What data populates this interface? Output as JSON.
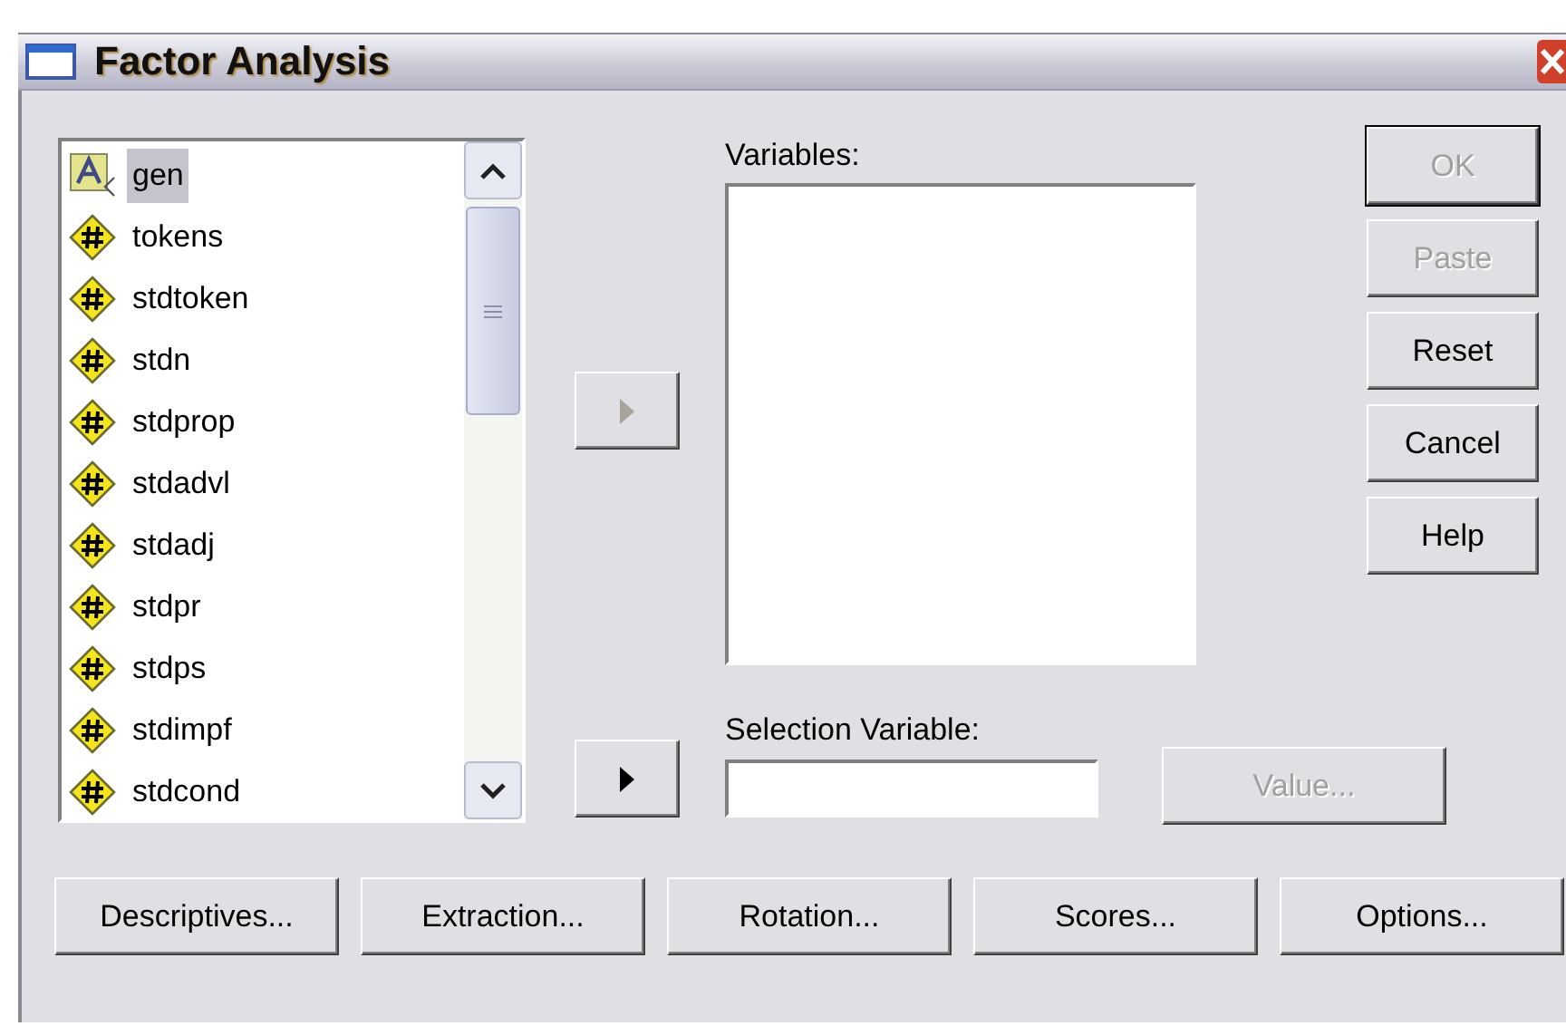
{
  "window": {
    "title": "Factor Analysis"
  },
  "source_list": {
    "items": [
      {
        "name": "gen",
        "kind": "string",
        "selected": true
      },
      {
        "name": "tokens",
        "kind": "numeric",
        "selected": false
      },
      {
        "name": "stdtoken",
        "kind": "numeric",
        "selected": false
      },
      {
        "name": "stdn",
        "kind": "numeric",
        "selected": false
      },
      {
        "name": "stdprop",
        "kind": "numeric",
        "selected": false
      },
      {
        "name": "stdadvl",
        "kind": "numeric",
        "selected": false
      },
      {
        "name": "stdadj",
        "kind": "numeric",
        "selected": false
      },
      {
        "name": "stdpr",
        "kind": "numeric",
        "selected": false
      },
      {
        "name": "stdps",
        "kind": "numeric",
        "selected": false
      },
      {
        "name": "stdimpf",
        "kind": "numeric",
        "selected": false
      },
      {
        "name": "stdcond",
        "kind": "numeric",
        "selected": false
      }
    ]
  },
  "move_buttons": [
    {
      "disabled": true
    },
    {
      "disabled": false
    }
  ],
  "variables": {
    "label": "Variables:"
  },
  "selection_variable": {
    "label": "Selection Variable:",
    "value_button": {
      "label": "Value...",
      "disabled": true
    }
  },
  "action_buttons": [
    {
      "label": "OK",
      "disabled": true,
      "default": true
    },
    {
      "label": "Paste",
      "disabled": true,
      "default": false
    },
    {
      "label": "Reset",
      "disabled": false,
      "default": false
    },
    {
      "label": "Cancel",
      "disabled": false,
      "default": false
    },
    {
      "label": "Help",
      "disabled": false,
      "default": false
    }
  ],
  "bottom_buttons": [
    {
      "label": "Descriptives..."
    },
    {
      "label": "Extraction..."
    },
    {
      "label": "Rotation..."
    },
    {
      "label": "Scores..."
    },
    {
      "label": "Options..."
    }
  ]
}
